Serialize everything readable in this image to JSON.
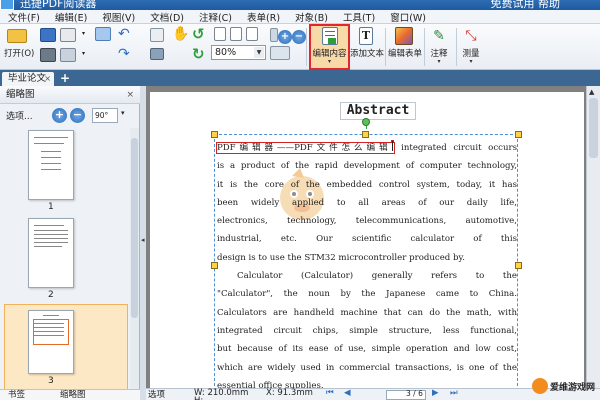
{
  "window": {
    "title": "迅捷PDF阅读器",
    "right_text": "免费试用    帮助"
  },
  "menu": [
    "文件(F)",
    "编辑(E)",
    "视图(V)",
    "文档(D)",
    "注释(C)",
    "表单(R)",
    "对象(B)",
    "工具(T)",
    "窗口(W)"
  ],
  "toolbar": {
    "open_label": "打开(O)",
    "zoom_value": "80%",
    "buttons": [
      {
        "label": "编辑内容"
      },
      {
        "label": "添加文本"
      },
      {
        "label": "编辑表单"
      },
      {
        "label": "注释"
      },
      {
        "label": "测量"
      }
    ]
  },
  "tabs": [
    {
      "label": "毕业论文"
    }
  ],
  "thumbnail_panel": {
    "title": "缩略图",
    "options_label": "选项...",
    "rotate_value": "90°",
    "pages": [
      "1",
      "2",
      "3"
    ],
    "selected_page": "3",
    "bottom_tabs": [
      "书签",
      "缩略图"
    ]
  },
  "document": {
    "heading": "Abstract",
    "first_line_highlight": "PDF编辑器——PDF文件怎么编辑",
    "first_line_rest": "integrated circuit occurs",
    "lines": [
      "is a product of the rapid development of computer technology,",
      "it is the core of the embedded control system, today, it has",
      "been widely applied to all areas of our daily life,",
      "electronics, technology, telecommunications, automotive,",
      "industrial, etc. Our scientific calculator of this",
      "design is to use the STM32 microcontroller produced by.",
      "Calculator (Calculator) generally refers to the",
      "\"Calculator\", the noun by the Japanese came to China.",
      "Calculators are handheld machine that can do the math, with",
      "integrated circuit chips, simple structure, less functional,",
      "but because of its ease of use, simple operation and low cost,",
      "which are widely used in commercial transactions, is one of the",
      "essential office supplies."
    ]
  },
  "statusbar": {
    "mode": "选项",
    "width": "W: 210.0mm",
    "height": "H:",
    "x": "X: 91.3mm",
    "page": "3 / 6",
    "watermark_text": "爱维游戏网"
  },
  "colors": {
    "title_blue": "#1f5a9e",
    "tab_strip": "#3d6793",
    "selected_outline": "#e2262b",
    "selection_frame": "#4a8fd8",
    "handle": "#ffd24a"
  }
}
